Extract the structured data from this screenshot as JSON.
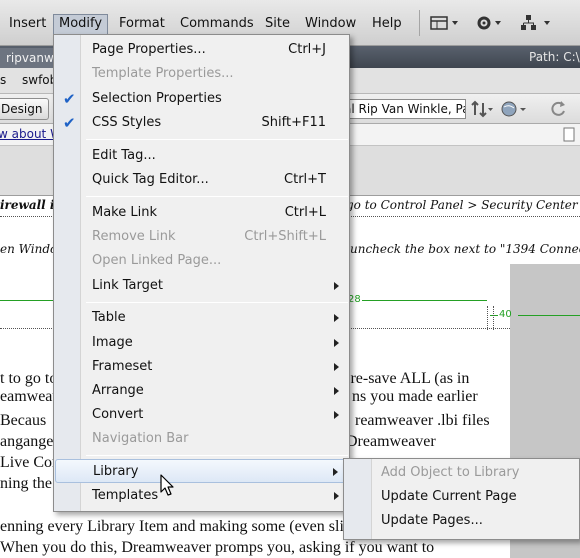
{
  "menubar": {
    "items": [
      {
        "label": "Insert"
      },
      {
        "label": "Modify"
      },
      {
        "label": "Format"
      },
      {
        "label": "Commands"
      },
      {
        "label": "Site"
      },
      {
        "label": "Window"
      },
      {
        "label": "Help"
      }
    ],
    "tools": [
      "layout-icon",
      "gear-icon",
      "site-icon"
    ]
  },
  "docbar": {
    "tab": "ripvanwin",
    "path_label": "Path: C:\\"
  },
  "related_files": {
    "item_s": "s",
    "item_swfob": "swfob"
  },
  "doc_toolbar": {
    "design_button": "Design",
    "title_value": "al Rip Van Winkle, Par"
  },
  "address_row": {
    "link_text": "w about W"
  },
  "notice": {
    "line1_left": "irewall in",
    "line1_right": "go to Control Panel > Security Center",
    "line2_left": "en Window",
    "line2_right": "uncheck the box next to \"1394 Connec"
  },
  "ruler": {
    "mark_28": "28",
    "mark_40": "40"
  },
  "body_text": {
    "line1_left": "t to go to",
    "line1_right": "l re-save ALL (as in",
    "line2_left": "eamweav",
    "line2_right": "ns you made earlier",
    "line3_left": "Becaus",
    "line3_right": "reamweaver .lbi files",
    "line4_left": "anganges",
    "line4_right": "Dreamweaver",
    "line5_left": "Live Cor",
    "line6_left": "ning the s",
    "line7": "enning every Library Item and making some (even sli",
    "line8": "When you do this, Dreamweaver promps you, asking if you want to"
  },
  "modify_menu": {
    "items": [
      {
        "label": "Page Properties...",
        "shortcut": "Ctrl+J"
      },
      {
        "label": "Template Properties..."
      },
      {
        "label": "Selection Properties",
        "checked": "✔"
      },
      {
        "label": "CSS Styles",
        "shortcut": "Shift+F11",
        "checked": "✔"
      },
      {
        "label": "Edit Tag..."
      },
      {
        "label": "Quick Tag Editor...",
        "shortcut": "Ctrl+T"
      },
      {
        "label": "Make Link",
        "shortcut": "Ctrl+L"
      },
      {
        "label": "Remove Link",
        "shortcut": "Ctrl+Shift+L"
      },
      {
        "label": "Open Linked Page..."
      },
      {
        "label": "Link Target"
      },
      {
        "label": "Table"
      },
      {
        "label": "Image"
      },
      {
        "label": "Frameset"
      },
      {
        "label": "Arrange"
      },
      {
        "label": "Convert"
      },
      {
        "label": "Navigation Bar"
      },
      {
        "label": "Library"
      },
      {
        "label": "Templates"
      }
    ]
  },
  "library_submenu": {
    "items": [
      {
        "label": "Add Object to Library"
      },
      {
        "label": "Update Current Page"
      },
      {
        "label": "Update Pages..."
      }
    ]
  },
  "colors": {
    "menu_bg": "#f0f0f0",
    "check": "#1f62c6",
    "ruler_green": "#24a024",
    "highlight_border": "#a9c0de"
  }
}
